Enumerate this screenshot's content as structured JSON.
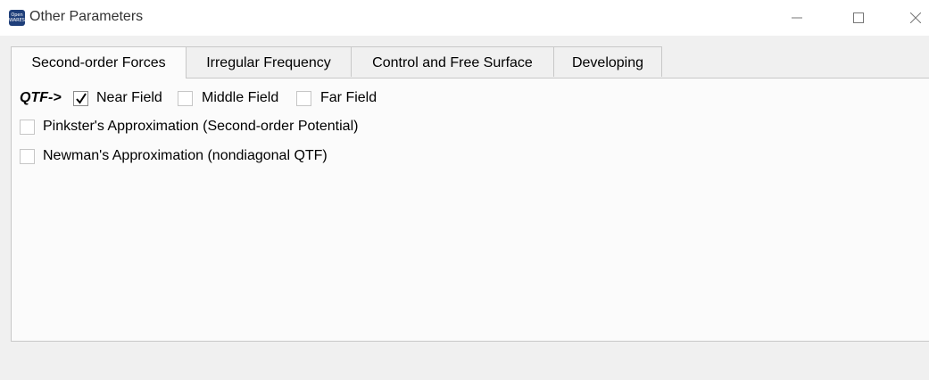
{
  "window": {
    "title": "Other Parameters",
    "icon_name": "app-icon",
    "icon_text": "Open WARES"
  },
  "tabs": [
    {
      "label": "Second-order Forces",
      "active": true
    },
    {
      "label": "Irregular Frequency",
      "active": false
    },
    {
      "label": "Control and Free Surface",
      "active": false
    },
    {
      "label": "Developing",
      "active": false
    }
  ],
  "qtf": {
    "prefix": "QTF->",
    "options": [
      {
        "label": "Near Field",
        "checked": true
      },
      {
        "label": "Middle Field",
        "checked": false
      },
      {
        "label": "Far Field",
        "checked": false
      }
    ]
  },
  "approximations": [
    {
      "label": "Pinkster's Approximation (Second-order Potential)",
      "checked": false
    },
    {
      "label": "Newman's Approximation (nondiagonal QTF)",
      "checked": false
    }
  ],
  "colors": {
    "titlebar_bg": "#ffffff",
    "window_bg": "#f0f0f0",
    "panel_bg": "#fbfbfb",
    "border": "#c8c8c8"
  }
}
